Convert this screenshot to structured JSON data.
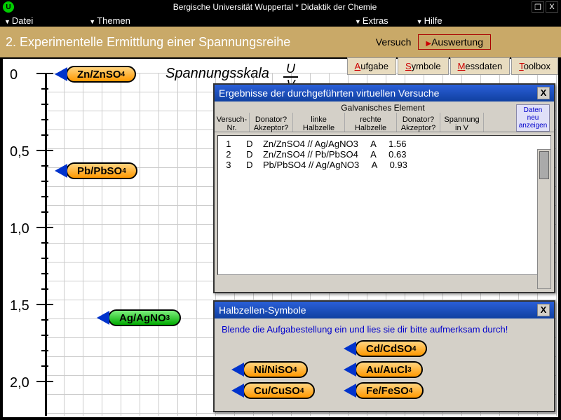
{
  "titlebar": {
    "logo": "U",
    "title": "Bergische Universität Wuppertal   *   Didaktik der Chemie"
  },
  "menu": {
    "datei": "Datei",
    "themen": "Themen",
    "extras": "Extras",
    "hilfe": "Hilfe"
  },
  "header": {
    "title": "2. Experimentelle Ermittlung einer Spannungsreihe",
    "tab_versuch": "Versuch",
    "tab_auswertung": "Auswertung"
  },
  "tooltabs": {
    "aufgabe": "ufgabe",
    "symbole": "ymbole",
    "messdaten": "essdaten",
    "toolbox": "oolbox",
    "aufgabe_u": "A",
    "symbole_u": "S",
    "messdaten_u": "M",
    "toolbox_u": "T"
  },
  "scale": {
    "title": "Spannungsskala",
    "frac_top": "U",
    "frac_bot": "V",
    "labels": {
      "l0": "0",
      "l05": "0,5",
      "l10": "1,0",
      "l15": "1,5",
      "l20": "2,0"
    }
  },
  "placed": {
    "zn": "Zn/ZnSO",
    "zn_sub": "4",
    "pb": "Pb/PbSO",
    "pb_sub": "4",
    "ag": "Ag/AgNO",
    "ag_sub": "3"
  },
  "results": {
    "title": "Ergebnisse der durchgeführten virtuellen Versuche",
    "group": "Galvanisches Element",
    "cols": {
      "nr": "Versuch-\nNr.",
      "d1": "Donator?\nAkzeptor?",
      "lh": "linke\nHalbzelle",
      "rh": "rechte\nHalbzelle",
      "d2": "Donator?\nAkzeptor?",
      "sp": "Spannung\nin V"
    },
    "btn_refresh": "Daten neu anzeigen",
    "rows": [
      {
        "nr": "1",
        "d1": "D",
        "lh": "Zn/ZnSO4",
        "rh": "Ag/AgNO3",
        "d2": "A",
        "v": "1.56"
      },
      {
        "nr": "2",
        "d1": "D",
        "lh": "Zn/ZnSO4",
        "rh": "Pb/PbSO4",
        "d2": "A",
        "v": "0.63"
      },
      {
        "nr": "3",
        "d1": "D",
        "lh": "Pb/PbSO4",
        "rh": "Ag/AgNO3",
        "d2": "A",
        "v": "0.93"
      }
    ],
    "rowtext": {
      "r0": "  1      D    Zn/ZnSO4 // Ag/AgNO3     A     1.56",
      "r1": "  2      D    Zn/ZnSO4 // Pb/PbSO4     A     0.63",
      "r2": "  3      D    Pb/PbSO4 // Ag/AgNO3     A     0.93"
    }
  },
  "symbols": {
    "title": "Halbzellen-Symbole",
    "instr": "Blende die Aufgabestellung ein und lies sie dir bitte aufmerksam durch!",
    "cd": "Cd/CdSO",
    "cd_sub": "4",
    "ni": "Ni/NiSO",
    "ni_sub": "4",
    "au": "Au/AuCl",
    "au_sub": "3",
    "cu": "Cu/CuSO",
    "cu_sub": "4",
    "fe": "Fe/FeSO",
    "fe_sub": "4"
  }
}
